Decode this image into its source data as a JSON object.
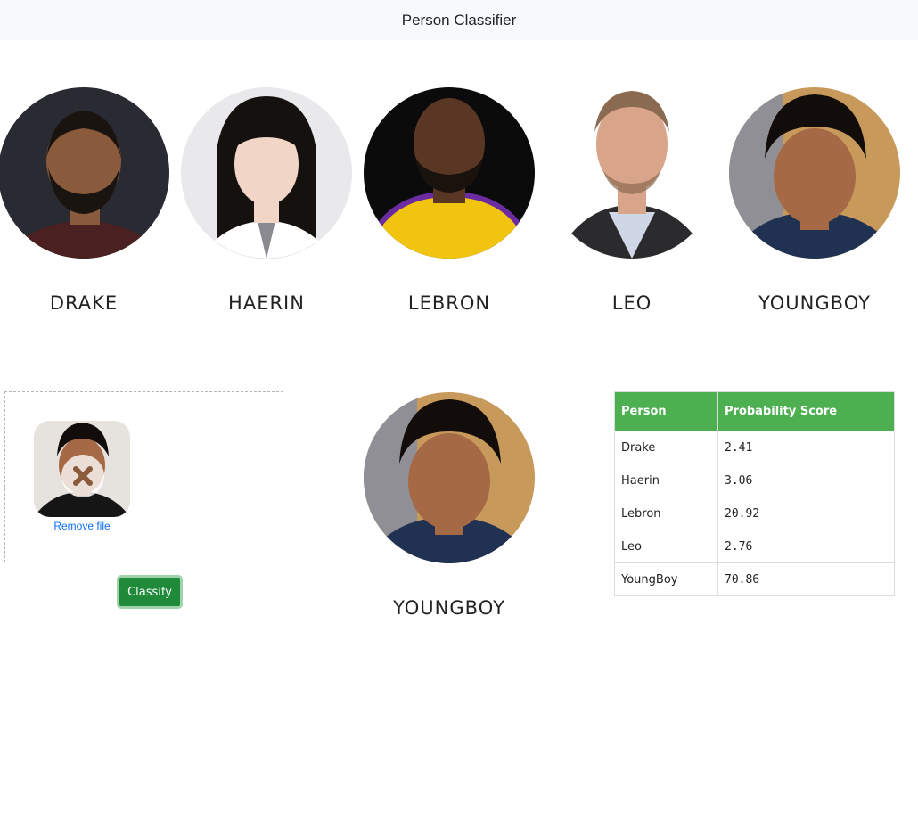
{
  "header": {
    "title": "Person Classifier"
  },
  "people": [
    {
      "name": "DRAKE",
      "skin": "#8a5a3c",
      "hair": "#1a1410",
      "bg": "#2a2a33",
      "cloth": "#4a2020"
    },
    {
      "name": "HAERIN",
      "skin": "#f1d6c8",
      "hair": "#15110f",
      "bg": "#e9e9ec",
      "cloth": "#ffffff"
    },
    {
      "name": "LEBRON",
      "skin": "#5a3624",
      "hair": "#1a120d",
      "bg": "#0b0b0b",
      "cloth": "#f1c40f"
    },
    {
      "name": "LEO",
      "skin": "#d9a58a",
      "hair": "#8a6a50",
      "bg": "#ffffff",
      "cloth": "#cfd6e6"
    },
    {
      "name": "YOUNGBOY",
      "skin": "#a56a45",
      "hair": "#120d0a",
      "bg": "#c79a5b",
      "cloth": "#203152"
    }
  ],
  "upload": {
    "remove_label": "Remove file",
    "classify_label": "Classify"
  },
  "result": {
    "name": "YOUNGBOY",
    "table": {
      "headers": [
        "Person",
        "Probability Score"
      ],
      "rows": [
        [
          "Drake",
          "2.41"
        ],
        [
          "Haerin",
          "3.06"
        ],
        [
          "Lebron",
          "20.92"
        ],
        [
          "Leo",
          "2.76"
        ],
        [
          "YoungBoy",
          "70.86"
        ]
      ]
    }
  },
  "colors": {
    "accent": "#4caf50",
    "button": "#1e8a3a",
    "link": "#0d6efd"
  }
}
